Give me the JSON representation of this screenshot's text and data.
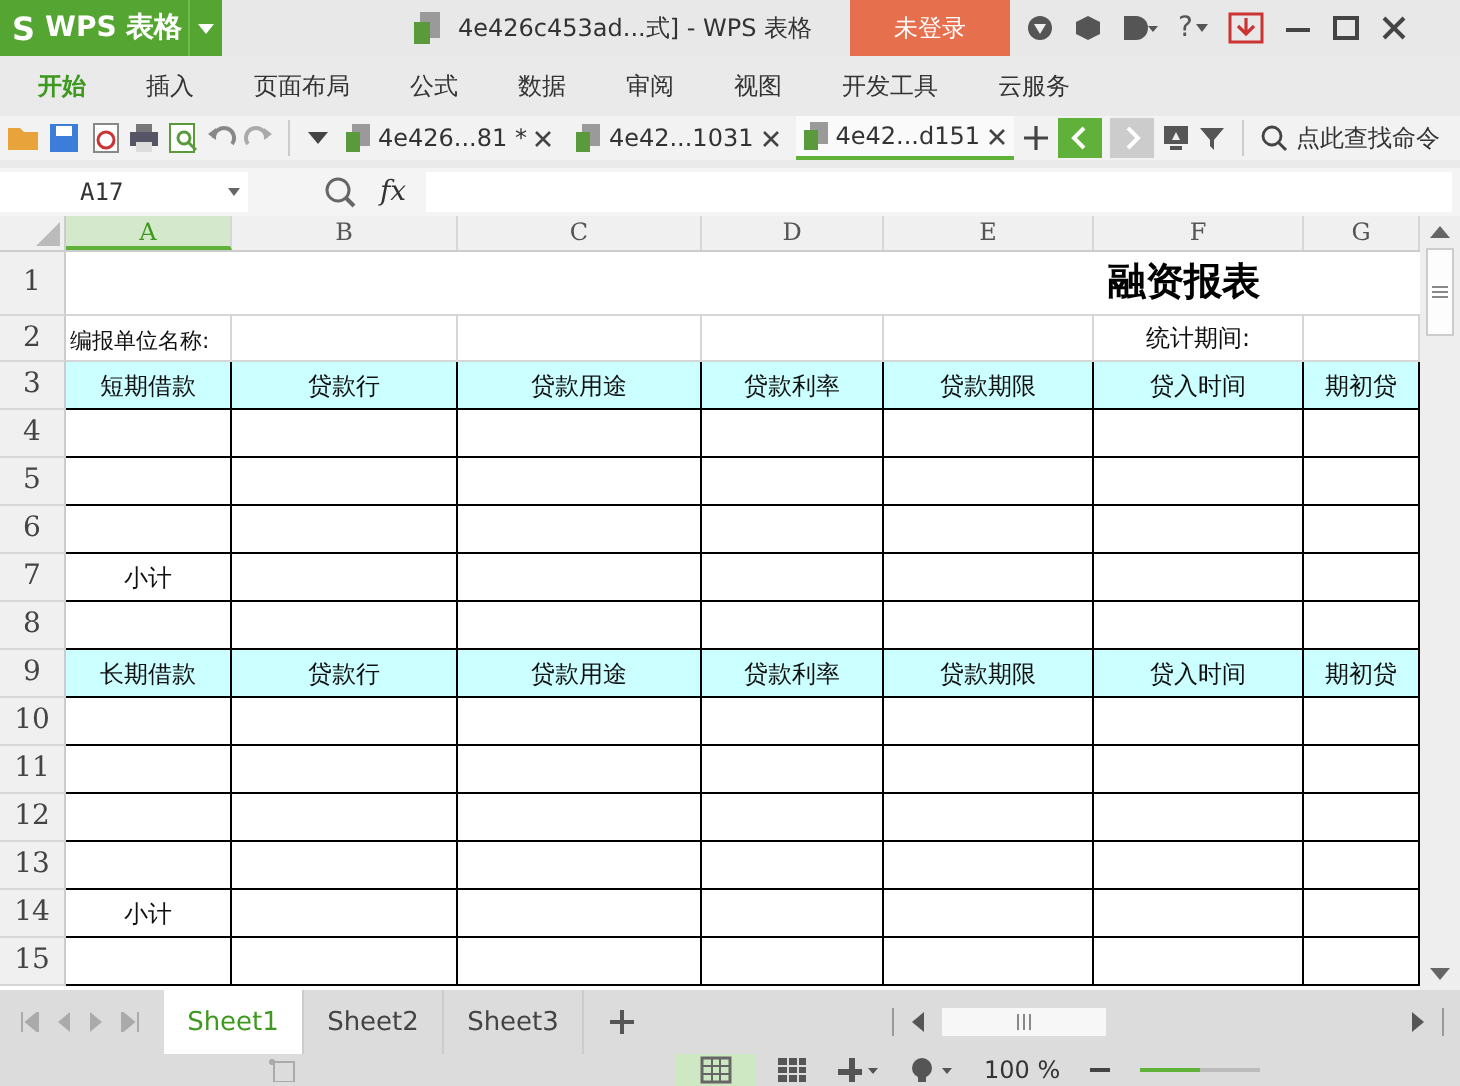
{
  "app": {
    "logo": "S",
    "name": "WPS 表格",
    "title": "4e426c453ad...式] - WPS 表格",
    "login": "未登录"
  },
  "ribbon_tabs": [
    {
      "label": "开始",
      "selected": true
    },
    {
      "label": "插入",
      "selected": false
    },
    {
      "label": "页面布局",
      "selected": false
    },
    {
      "label": "公式",
      "selected": false
    },
    {
      "label": "数据",
      "selected": false
    },
    {
      "label": "审阅",
      "selected": false
    },
    {
      "label": "视图",
      "selected": false
    },
    {
      "label": "开发工具",
      "selected": false
    },
    {
      "label": "云服务",
      "selected": false
    }
  ],
  "doc_tabs": [
    {
      "label": "4e426...81 *",
      "selected": false
    },
    {
      "label": "4e42...1031",
      "selected": false
    },
    {
      "label": "4e42...d151",
      "selected": true
    }
  ],
  "search": {
    "placeholder": "点此查找命令"
  },
  "formula_bar": {
    "cell_ref": "A17",
    "fx": "fx"
  },
  "columns": [
    {
      "label": "A",
      "selected": true
    },
    {
      "label": "B",
      "selected": false
    },
    {
      "label": "C",
      "selected": false
    },
    {
      "label": "D",
      "selected": false
    },
    {
      "label": "E",
      "selected": false
    },
    {
      "label": "F",
      "selected": false
    },
    {
      "label": "G",
      "selected": false
    }
  ],
  "rows": [
    {
      "number": "1",
      "kind": "title",
      "title": "融资报表"
    },
    {
      "number": "2",
      "kind": "plain",
      "cells": [
        "编报单位名称:",
        null,
        null,
        null,
        null,
        "统计期间:",
        null
      ]
    },
    {
      "number": "3",
      "kind": "header",
      "cells": [
        "短期借款",
        "贷款行",
        "贷款用途",
        "贷款利率",
        "贷款期限",
        "贷入时间",
        "期初贷"
      ]
    },
    {
      "number": "4",
      "kind": "body",
      "cells": [
        null,
        null,
        null,
        null,
        null,
        null,
        null
      ]
    },
    {
      "number": "5",
      "kind": "body",
      "cells": [
        null,
        null,
        null,
        null,
        null,
        null,
        null
      ]
    },
    {
      "number": "6",
      "kind": "body",
      "cells": [
        null,
        null,
        null,
        null,
        null,
        null,
        null
      ]
    },
    {
      "number": "7",
      "kind": "body",
      "cells": [
        "小计",
        null,
        null,
        null,
        null,
        null,
        null
      ]
    },
    {
      "number": "8",
      "kind": "body",
      "cells": [
        null,
        null,
        null,
        null,
        null,
        null,
        null
      ]
    },
    {
      "number": "9",
      "kind": "header",
      "cells": [
        "长期借款",
        "贷款行",
        "贷款用途",
        "贷款利率",
        "贷款期限",
        "贷入时间",
        "期初贷"
      ]
    },
    {
      "number": "10",
      "kind": "body",
      "cells": [
        null,
        null,
        null,
        null,
        null,
        null,
        null
      ]
    },
    {
      "number": "11",
      "kind": "body",
      "cells": [
        null,
        null,
        null,
        null,
        null,
        null,
        null
      ]
    },
    {
      "number": "12",
      "kind": "body",
      "cells": [
        null,
        null,
        null,
        null,
        null,
        null,
        null
      ]
    },
    {
      "number": "13",
      "kind": "body",
      "cells": [
        null,
        null,
        null,
        null,
        null,
        null,
        null
      ]
    },
    {
      "number": "14",
      "kind": "body",
      "cells": [
        "小计",
        null,
        null,
        null,
        null,
        null,
        null
      ]
    },
    {
      "number": "15",
      "kind": "body",
      "cells": [
        null,
        null,
        null,
        null,
        null,
        null,
        null
      ]
    }
  ],
  "sheets": [
    {
      "label": "Sheet1",
      "selected": true
    },
    {
      "label": "Sheet2",
      "selected": false
    },
    {
      "label": "Sheet3",
      "selected": false
    }
  ],
  "status": {
    "zoom": "100 %",
    "zoom_slider": {
      "level": 0.5
    }
  },
  "help": "?"
}
